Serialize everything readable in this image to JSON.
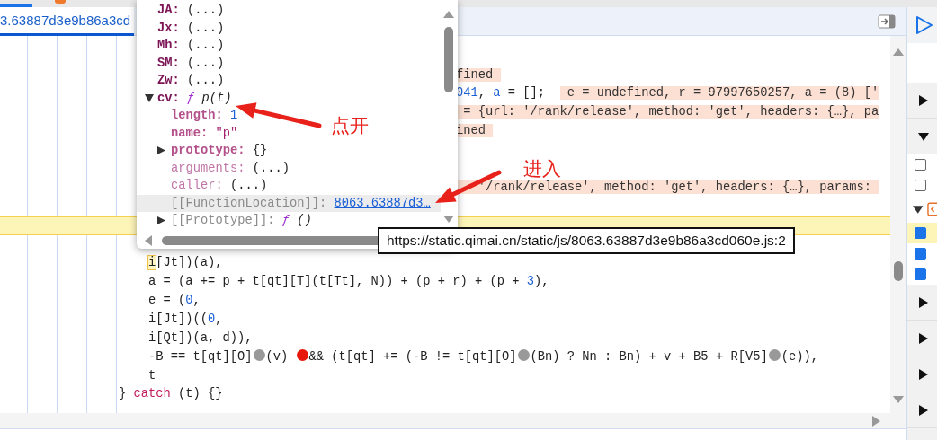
{
  "editor_tab": {
    "label": "3.63887d3e9b86a3cd",
    "selected": true
  },
  "code_lines": [
    {
      "kind": "blank"
    },
    {
      "kind": "behind",
      "segments": [
        {
          "kind": "value",
          "text": "fined "
        }
      ]
    },
    {
      "kind": "behind",
      "segments": [
        {
          "kind": "number",
          "text": "041"
        },
        {
          "kind": "plain",
          "text": ", "
        },
        {
          "kind": "number",
          "text": "a"
        },
        {
          "kind": "plain",
          "text": " = [];  "
        },
        {
          "kind": "value",
          "text": " e = undefined, r = 97997650257, a = (8) ['"
        }
      ]
    },
    {
      "kind": "behind",
      "segments": [
        {
          "kind": "value",
          "text": " = {url: '/rank/release', method: 'get', headers: {…}, pa"
        }
      ]
    },
    {
      "kind": "behind",
      "segments": [
        {
          "kind": "value",
          "text": "ined "
        }
      ]
    },
    {
      "kind": "blank"
    },
    {
      "kind": "blank"
    },
    {
      "kind": "behind",
      "segments": [
        {
          "kind": "value",
          "text": "   '/rank/release', method: 'get', headers: {…}, params: "
        }
      ]
    },
    {
      "kind": "blank"
    },
    {
      "kind": "highlight"
    },
    {
      "kind": "blank"
    },
    {
      "kind": "inner",
      "segments": [
        {
          "kind": "current",
          "text": "i"
        },
        {
          "kind": "plain",
          "text": "[Jt])(a),"
        }
      ]
    },
    {
      "kind": "inner",
      "segments": [
        {
          "kind": "plain",
          "text": "a = (a += p + t[qt][T](t[Tt], N)) + (p + r) + (p + "
        },
        {
          "kind": "number",
          "text": "3"
        },
        {
          "kind": "plain",
          "text": "),"
        }
      ]
    },
    {
      "kind": "inner",
      "segments": [
        {
          "kind": "plain",
          "text": "e = ("
        },
        {
          "kind": "number",
          "text": "0"
        },
        {
          "kind": "plain",
          "text": ","
        }
      ]
    },
    {
      "kind": "inner",
      "segments": [
        {
          "kind": "plain",
          "text": "i[Jt])(("
        },
        {
          "kind": "number",
          "text": "0"
        },
        {
          "kind": "plain",
          "text": ","
        }
      ]
    },
    {
      "kind": "inner",
      "segments": [
        {
          "kind": "plain",
          "text": "i[Qt])(a, d)),"
        }
      ]
    },
    {
      "kind": "inner",
      "segments": [
        {
          "kind": "plain",
          "text": "-B == t[qt][O]"
        },
        {
          "kind": "breakpoint",
          "active": false
        },
        {
          "kind": "plain",
          "text": "(v) "
        },
        {
          "kind": "breakpoint",
          "active": true
        },
        {
          "kind": "plain",
          "text": "&& (t[qt] += (-B != t[qt][O]"
        },
        {
          "kind": "breakpoint",
          "active": false
        },
        {
          "kind": "plain",
          "text": "(Bn) ? Nn : Bn) + v + B5 + R[V5]"
        },
        {
          "kind": "breakpoint",
          "active": false
        },
        {
          "kind": "plain",
          "text": "(e)),"
        }
      ]
    },
    {
      "kind": "inner",
      "segments": [
        {
          "kind": "plain",
          "text": "t"
        }
      ]
    },
    {
      "kind": "outer",
      "segments": [
        {
          "kind": "plain",
          "text": "} "
        },
        {
          "kind": "keyword",
          "text": "catch"
        },
        {
          "kind": "plain",
          "text": " (t) {}"
        }
      ]
    }
  ],
  "popover": {
    "properties": [
      {
        "kind": "own",
        "key": "JA:",
        "value": {
          "kind": "lazy",
          "text": "(...)"
        },
        "hovered": false
      },
      {
        "kind": "own",
        "key": "Jx:",
        "value": {
          "kind": "lazy",
          "text": "(...)"
        },
        "hovered": false
      },
      {
        "kind": "own",
        "key": "Mh:",
        "value": {
          "kind": "lazy",
          "text": "(...)"
        },
        "hovered": false
      },
      {
        "kind": "own",
        "key": "SM:",
        "value": {
          "kind": "lazy",
          "text": "(...)"
        },
        "hovered": false
      },
      {
        "kind": "own",
        "key": "Zw:",
        "value": {
          "kind": "lazy",
          "text": "(...)"
        },
        "hovered": false
      },
      {
        "kind": "own",
        "key": "cv:",
        "value": {
          "kind": "function",
          "mark": "ƒ",
          "text": "p(t)"
        },
        "expanded": true,
        "hovered": false,
        "children": [
          {
            "kind": "child",
            "key": "length:",
            "value": {
              "kind": "number",
              "text": "1"
            },
            "hovered": false
          },
          {
            "kind": "child",
            "key": "name:",
            "value": {
              "kind": "string",
              "text": "\"p\""
            },
            "hovered": false
          },
          {
            "kind": "child",
            "key": "prototype:",
            "value": {
              "kind": "object",
              "text": "{}"
            },
            "expanded": false,
            "hovered": false
          },
          {
            "kind": "nonenum",
            "key": "arguments:",
            "value": {
              "kind": "lazy",
              "text": "(...)"
            },
            "hovered": false
          },
          {
            "kind": "nonenum",
            "key": "caller:",
            "value": {
              "kind": "lazy",
              "text": "(...)"
            },
            "hovered": false
          },
          {
            "kind": "internal",
            "key": "[[FunctionLocation]]:",
            "value": {
              "kind": "link",
              "text": "8063.63887d3…"
            },
            "hovered": true
          },
          {
            "kind": "internal",
            "key": "[[Prototype]]:",
            "value": {
              "kind": "function",
              "mark": "ƒ",
              "text": "()"
            },
            "expanded": false,
            "hovered": false
          }
        ]
      }
    ]
  },
  "tooltip": "https://static.qimai.cn/static/js/8063.63887d3e9b86a3cd060e.js:2",
  "annotations": [
    {
      "text": "点开"
    },
    {
      "text": "进入"
    }
  ],
  "sidebar": {
    "rows": [
      {
        "kind": "toolbar"
      },
      {
        "kind": "empty"
      },
      {
        "kind": "section",
        "expanded": false
      },
      {
        "kind": "section",
        "expanded": true
      },
      {
        "kind": "checkbox",
        "checked": false,
        "highlighted": false
      },
      {
        "kind": "checkbox",
        "checked": false,
        "highlighted": false
      },
      {
        "kind": "file",
        "expanded": true
      },
      {
        "kind": "checkbox",
        "checked": true,
        "highlighted": true
      },
      {
        "kind": "checkbox",
        "checked": true,
        "highlighted": false
      },
      {
        "kind": "checkbox",
        "checked": true,
        "highlighted": false
      },
      {
        "kind": "section",
        "expanded": false
      },
      {
        "kind": "section",
        "expanded": false
      },
      {
        "kind": "section",
        "expanded": false
      },
      {
        "kind": "section",
        "expanded": false
      }
    ]
  }
}
